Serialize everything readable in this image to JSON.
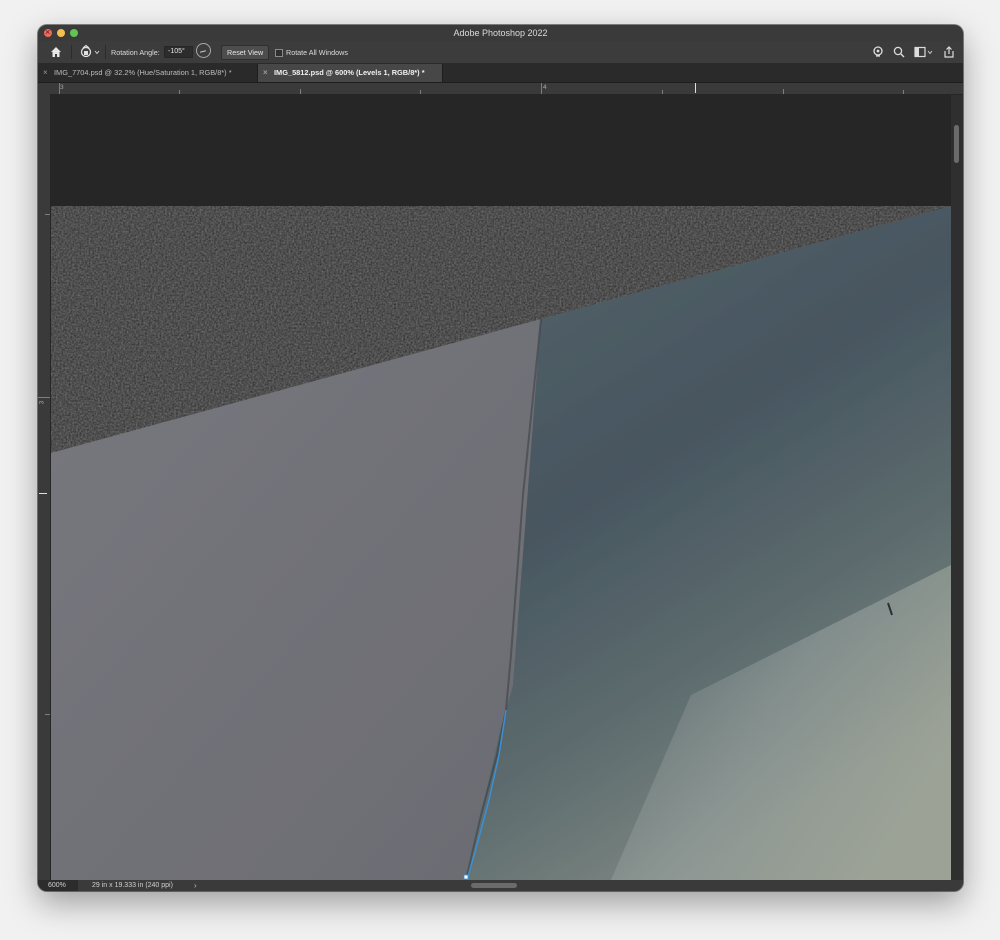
{
  "app": {
    "window_title": "Adobe Photoshop 2022"
  },
  "options_bar": {
    "rotation_angle_label": "Rotation Angle:",
    "rotation_angle_value": "-105°",
    "reset_view_label": "Reset View",
    "rotate_all_windows_label": "Rotate All Windows",
    "rotate_all_windows_checked": false
  },
  "tabs": [
    {
      "label": "IMG_7704.psd @ 32.2% (Hue/Saturation 1, RGB/8*) *",
      "active": false
    },
    {
      "label": "IMG_5812.psd @ 600% (Levels 1, RGB/8*) *",
      "active": true
    }
  ],
  "rulers": {
    "horizontal_labels": [
      "3",
      "4"
    ],
    "vertical_labels": [
      "3"
    ]
  },
  "status_bar": {
    "zoom": "600%",
    "document_info": "29 in x 19.333 in (240 ppi)",
    "arrow": "›"
  },
  "colors": {
    "app_chrome": "#323232",
    "canvas_background": "#262626",
    "gray_paper": "#6f7076",
    "blue_green_paper": "#4c5a62",
    "selection_path": "#3b8fd6"
  }
}
